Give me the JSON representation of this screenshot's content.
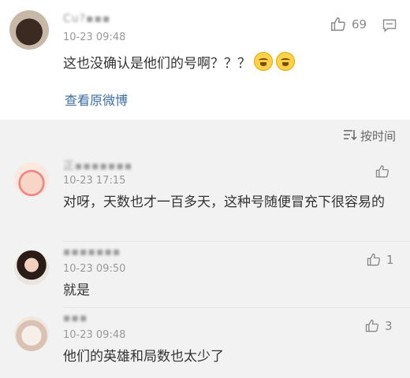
{
  "post": {
    "username": "Cu?▪▪▪",
    "time": "10-23 09:48",
    "text": "这也没确认是他们的号啊？？？",
    "likes": "69",
    "view_link": "查看原微博",
    "emojis": [
      "laugh-cry-emoji",
      "laugh-cry-emoji"
    ]
  },
  "sort": {
    "label": "按时间"
  },
  "comments": [
    {
      "username": "正▪▪▪▪▪▪▪",
      "time": "10-23 17:15",
      "text": "对呀，天数也才一百多天，这种号随便冒充下很容易的",
      "likes": ""
    },
    {
      "username": "▪▪▪▪▪▪▪",
      "time": "10-23 09:50",
      "text": "就是",
      "likes": "1"
    },
    {
      "username": "▪▪▪",
      "time": "10-23 09:48",
      "text": "他们的英雄和局数也太少了",
      "likes": "3"
    }
  ],
  "colors": {
    "link": "#3b6fa3",
    "muted": "#999999",
    "text": "#333333",
    "background": "#f2f2f2"
  }
}
